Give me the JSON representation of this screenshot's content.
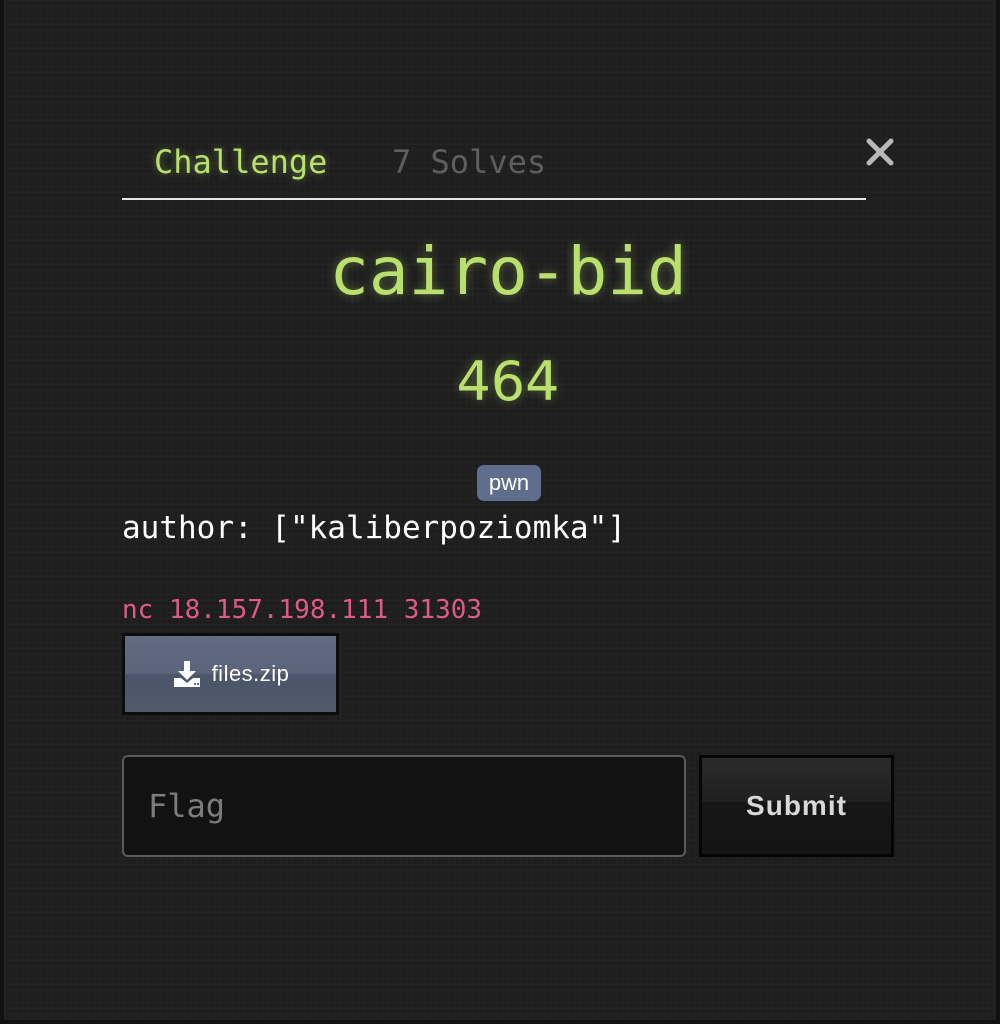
{
  "tabs": {
    "challenge": "Challenge",
    "solves": "7 Solves"
  },
  "challenge": {
    "name": "cairo-bid",
    "points": "464",
    "tag": "pwn",
    "author": "author: [\"kaliberpoziomka\"]",
    "connection": "nc 18.157.198.111 31303",
    "file": "files.zip"
  },
  "form": {
    "flag_placeholder": "Flag",
    "flag_value": "",
    "submit_label": "Submit"
  },
  "icons": {
    "close": "close-icon",
    "download": "download-icon"
  },
  "colors": {
    "accent": "#b9e06c",
    "connection": "#e05a86",
    "tag_bg": "#5e6e8c"
  }
}
